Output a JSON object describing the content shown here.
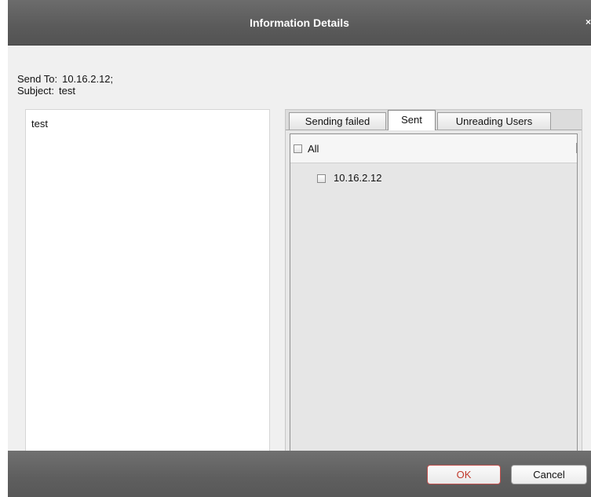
{
  "window": {
    "title": "Information Details",
    "close_glyph": "×",
    "close_icon": "close-icon"
  },
  "fields": {
    "send_to_label": "Send To:",
    "send_to_value": "10.16.2.12;",
    "subject_label": "Subject:",
    "subject_value": "test"
  },
  "message": {
    "body": "test"
  },
  "tabs": [
    {
      "label": "Sending failed",
      "active": false
    },
    {
      "label": "Sent",
      "active": true
    },
    {
      "label": "Unreading Users",
      "active": false
    }
  ],
  "recipients": {
    "all_label": "All",
    "all_checked": false,
    "items": [
      {
        "label": "10.16.2.12",
        "checked": false
      }
    ]
  },
  "buttons": {
    "ok_label": "OK",
    "cancel_label": "Cancel"
  },
  "colors": {
    "titlebar": "#5e5e5e",
    "ok_border": "#c0504d",
    "ok_text": "#c0392b"
  }
}
